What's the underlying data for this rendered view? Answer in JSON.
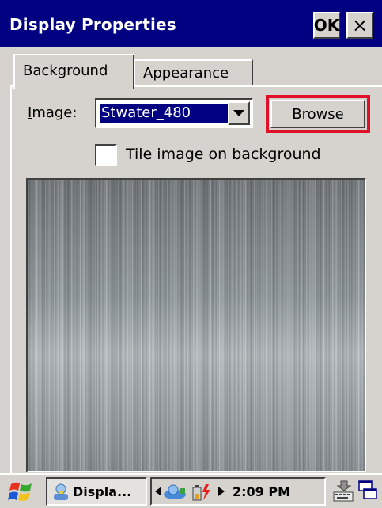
{
  "window": {
    "title": "Display Properties",
    "ok_label": "OK",
    "close_label": "×"
  },
  "tabs": [
    {
      "label": "Background",
      "active": true
    },
    {
      "label": "Appearance",
      "active": false
    }
  ],
  "background_tab": {
    "image_label_prefix": "I",
    "image_label_rest": "mage:",
    "image_value": "Stwater_480",
    "browse_label": "Browse",
    "tile_label": "Tile image on background",
    "tile_checked": false
  },
  "taskbar": {
    "task_label": "Displa...",
    "time": "2:09 PM",
    "icons": [
      "windows-start-icon",
      "display-properties-icon",
      "network-icon",
      "battery-power-icon",
      "keyboard-icon",
      "desktop-icon"
    ]
  },
  "colors": {
    "title_bar": "#000080",
    "face": "#d6d3ce",
    "highlight_box": "#e0102a"
  }
}
